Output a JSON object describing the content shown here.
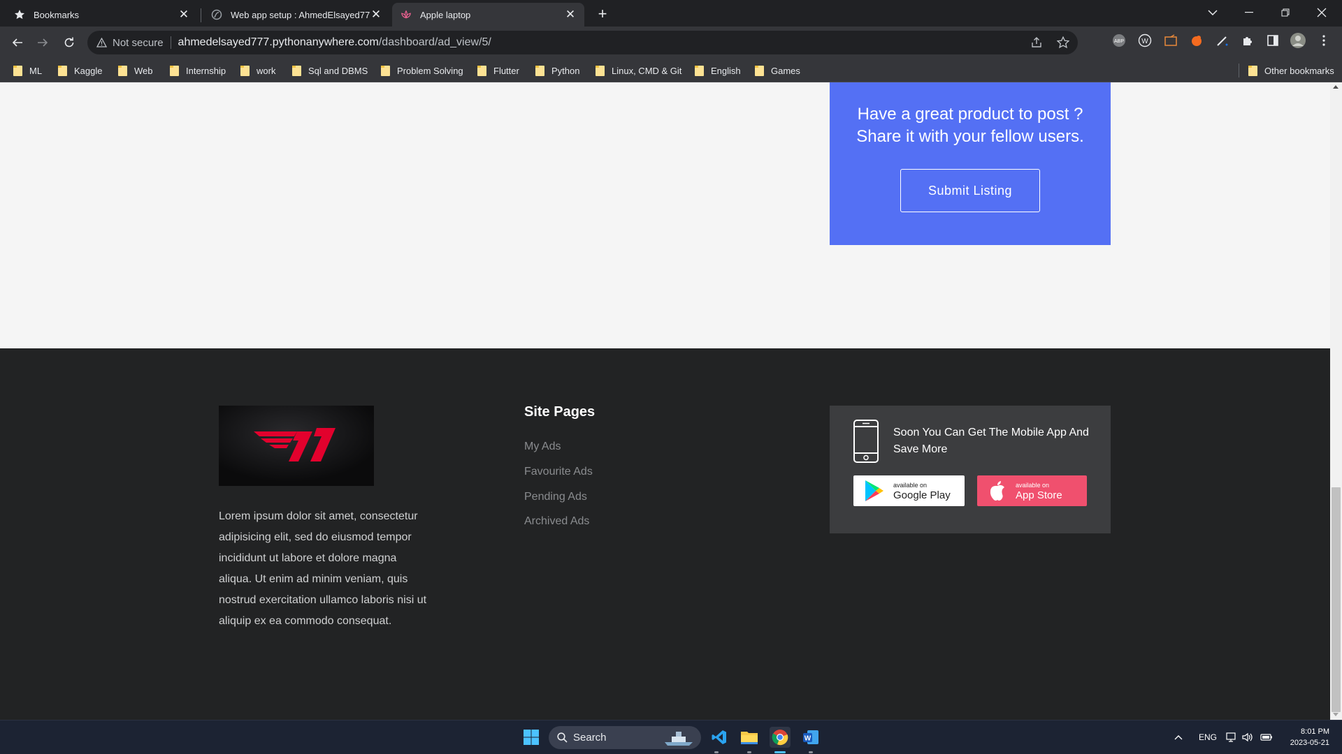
{
  "tabs": [
    {
      "label": "Bookmarks",
      "icon": "star-icon",
      "active": false
    },
    {
      "label": "Web app setup : AhmedElsayed777",
      "icon": "pythonanywhere-icon",
      "active": false
    },
    {
      "label": "Apple laptop",
      "icon": "lotus-icon",
      "active": true
    }
  ],
  "address": {
    "security_label": "Not secure",
    "domain": "ahmedelsayed777.pythonanywhere.com",
    "path": "/dashboard/ad_view/5/"
  },
  "bookmarks": [
    "ML",
    "Kaggle",
    "Web",
    "Internship",
    "work",
    "Sql and DBMS",
    "Problem Solving",
    "Flutter",
    "Python",
    "Linux, CMD & Git",
    "English",
    "Games"
  ],
  "other_bookmarks": "Other bookmarks",
  "promo": {
    "line1": "Have a great product to post ?",
    "line2": "Share it with your fellow users.",
    "button": "Submit Listing"
  },
  "footer": {
    "logo_alt": "T1",
    "about": "Lorem ipsum dolor sit amet, consectetur adipisicing elit, sed do eiusmod tempor incididunt ut labore et dolore magna aliqua. Ut enim ad minim veniam, quis nostrud exercitation ullamco laboris nisi ut aliquip ex ea commodo consequat.",
    "site_pages_title": "Site Pages",
    "site_pages": [
      "My Ads",
      "Favourite Ads",
      "Pending Ads",
      "Archived Ads"
    ],
    "app_text": "Soon You Can Get The Mobile App And Save More",
    "google_small": "available on",
    "google_big": "Google Play",
    "apple_small": "available on",
    "apple_big": "App Store"
  },
  "taskbar": {
    "search": "Search",
    "lang": "ENG",
    "time": "8:01 PM",
    "date": "2023-05-21"
  },
  "colors": {
    "promo_bg": "#5470f4",
    "footer_bg": "#222324",
    "app_store_bg": "#f0506e",
    "logo_red": "#e2012d"
  }
}
